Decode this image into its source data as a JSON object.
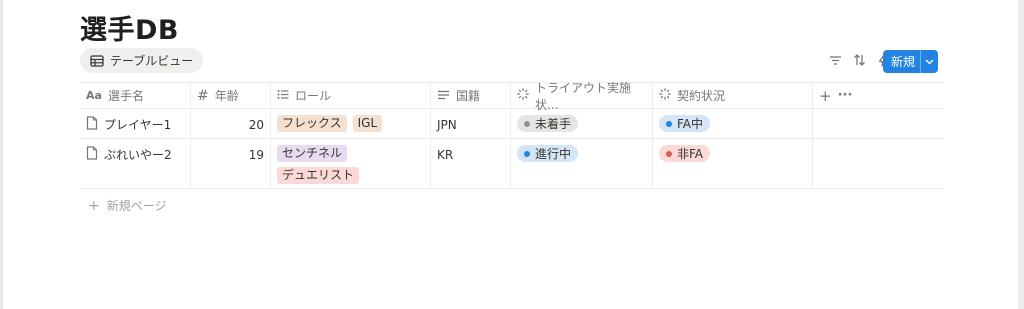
{
  "page": {
    "title": "選手DB"
  },
  "view": {
    "tab_label": "テーブルビュー",
    "icon": "table-icon"
  },
  "toolbar": {
    "icons": [
      "filter-icon",
      "sort-icon",
      "lightning-icon",
      "search-icon",
      "settings-sliders-icon"
    ],
    "new_label": "新規",
    "accent": "#2383e2"
  },
  "table": {
    "columns": [
      {
        "label": "選手名",
        "icon": "title-aa-icon"
      },
      {
        "label": "年齢",
        "icon": "hash-icon"
      },
      {
        "label": "ロール",
        "icon": "list-icon"
      },
      {
        "label": "国籍",
        "icon": "text-lines-icon"
      },
      {
        "label": "トライアウト実施状...",
        "icon": "status-spinner-icon"
      },
      {
        "label": "契約状況",
        "icon": "status-spinner-icon"
      }
    ],
    "add_column": "+",
    "more": "···",
    "rows": [
      {
        "name": "プレイヤー1",
        "age": "20",
        "roles": [
          {
            "label": "フレックス",
            "color": "#f4e0d0"
          },
          {
            "label": "IGL",
            "color": "#f4e0d0"
          }
        ],
        "nationality": "JPN",
        "tryout": {
          "label": "未着手",
          "color": "#e6e5e3",
          "dot": "#91918e"
        },
        "contract": {
          "label": "FA中",
          "color": "#d3e5f7",
          "dot": "#2383e2"
        }
      },
      {
        "name": "ぷれいやー2",
        "age": "19",
        "roles": [
          {
            "label": "センチネル",
            "color": "#e8dbf1"
          },
          {
            "label": "デュエリスト",
            "color": "#fbd9d6"
          }
        ],
        "nationality": "KR",
        "tryout": {
          "label": "進行中",
          "color": "#d3e5f7",
          "dot": "#2383e2"
        },
        "contract": {
          "label": "非FA",
          "color": "#fbd9d6",
          "dot": "#e0574f"
        }
      }
    ],
    "new_page": "新規ページ"
  }
}
